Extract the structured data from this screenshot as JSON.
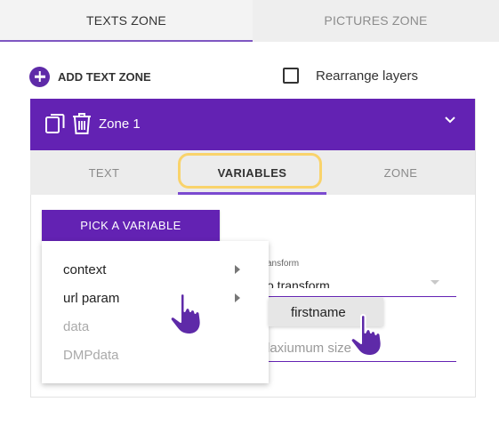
{
  "top_tabs": {
    "texts_zone": "TEXTS ZONE",
    "pictures_zone": "PICTURES ZONE"
  },
  "toolbar": {
    "add_text_zone": "ADD TEXT ZONE",
    "rearrange_layers": "Rearrange layers",
    "rearrange_checked": false
  },
  "zone": {
    "title": "Zone 1",
    "tabs": [
      "TEXT",
      "VARIABLES",
      "ZONE"
    ],
    "active_tab": "VARIABLES"
  },
  "variables": {
    "pick_button": "PICK A VARIABLE",
    "menu_items": [
      {
        "label": "context",
        "enabled": true,
        "has_submenu": true
      },
      {
        "label": "url param",
        "enabled": true,
        "has_submenu": true
      },
      {
        "label": "data",
        "enabled": false,
        "has_submenu": false
      },
      {
        "label": "DMPdata",
        "enabled": false,
        "has_submenu": false
      }
    ],
    "submenu_items": [
      "firstname"
    ]
  },
  "form": {
    "transform_label": "ansform",
    "transform_value": "o transform",
    "maxsize_placeholder": "laxiumum size"
  },
  "colors": {
    "primary": "#6322b3",
    "highlight": "#f9d36b",
    "tab_underline": "#7e57c2"
  }
}
